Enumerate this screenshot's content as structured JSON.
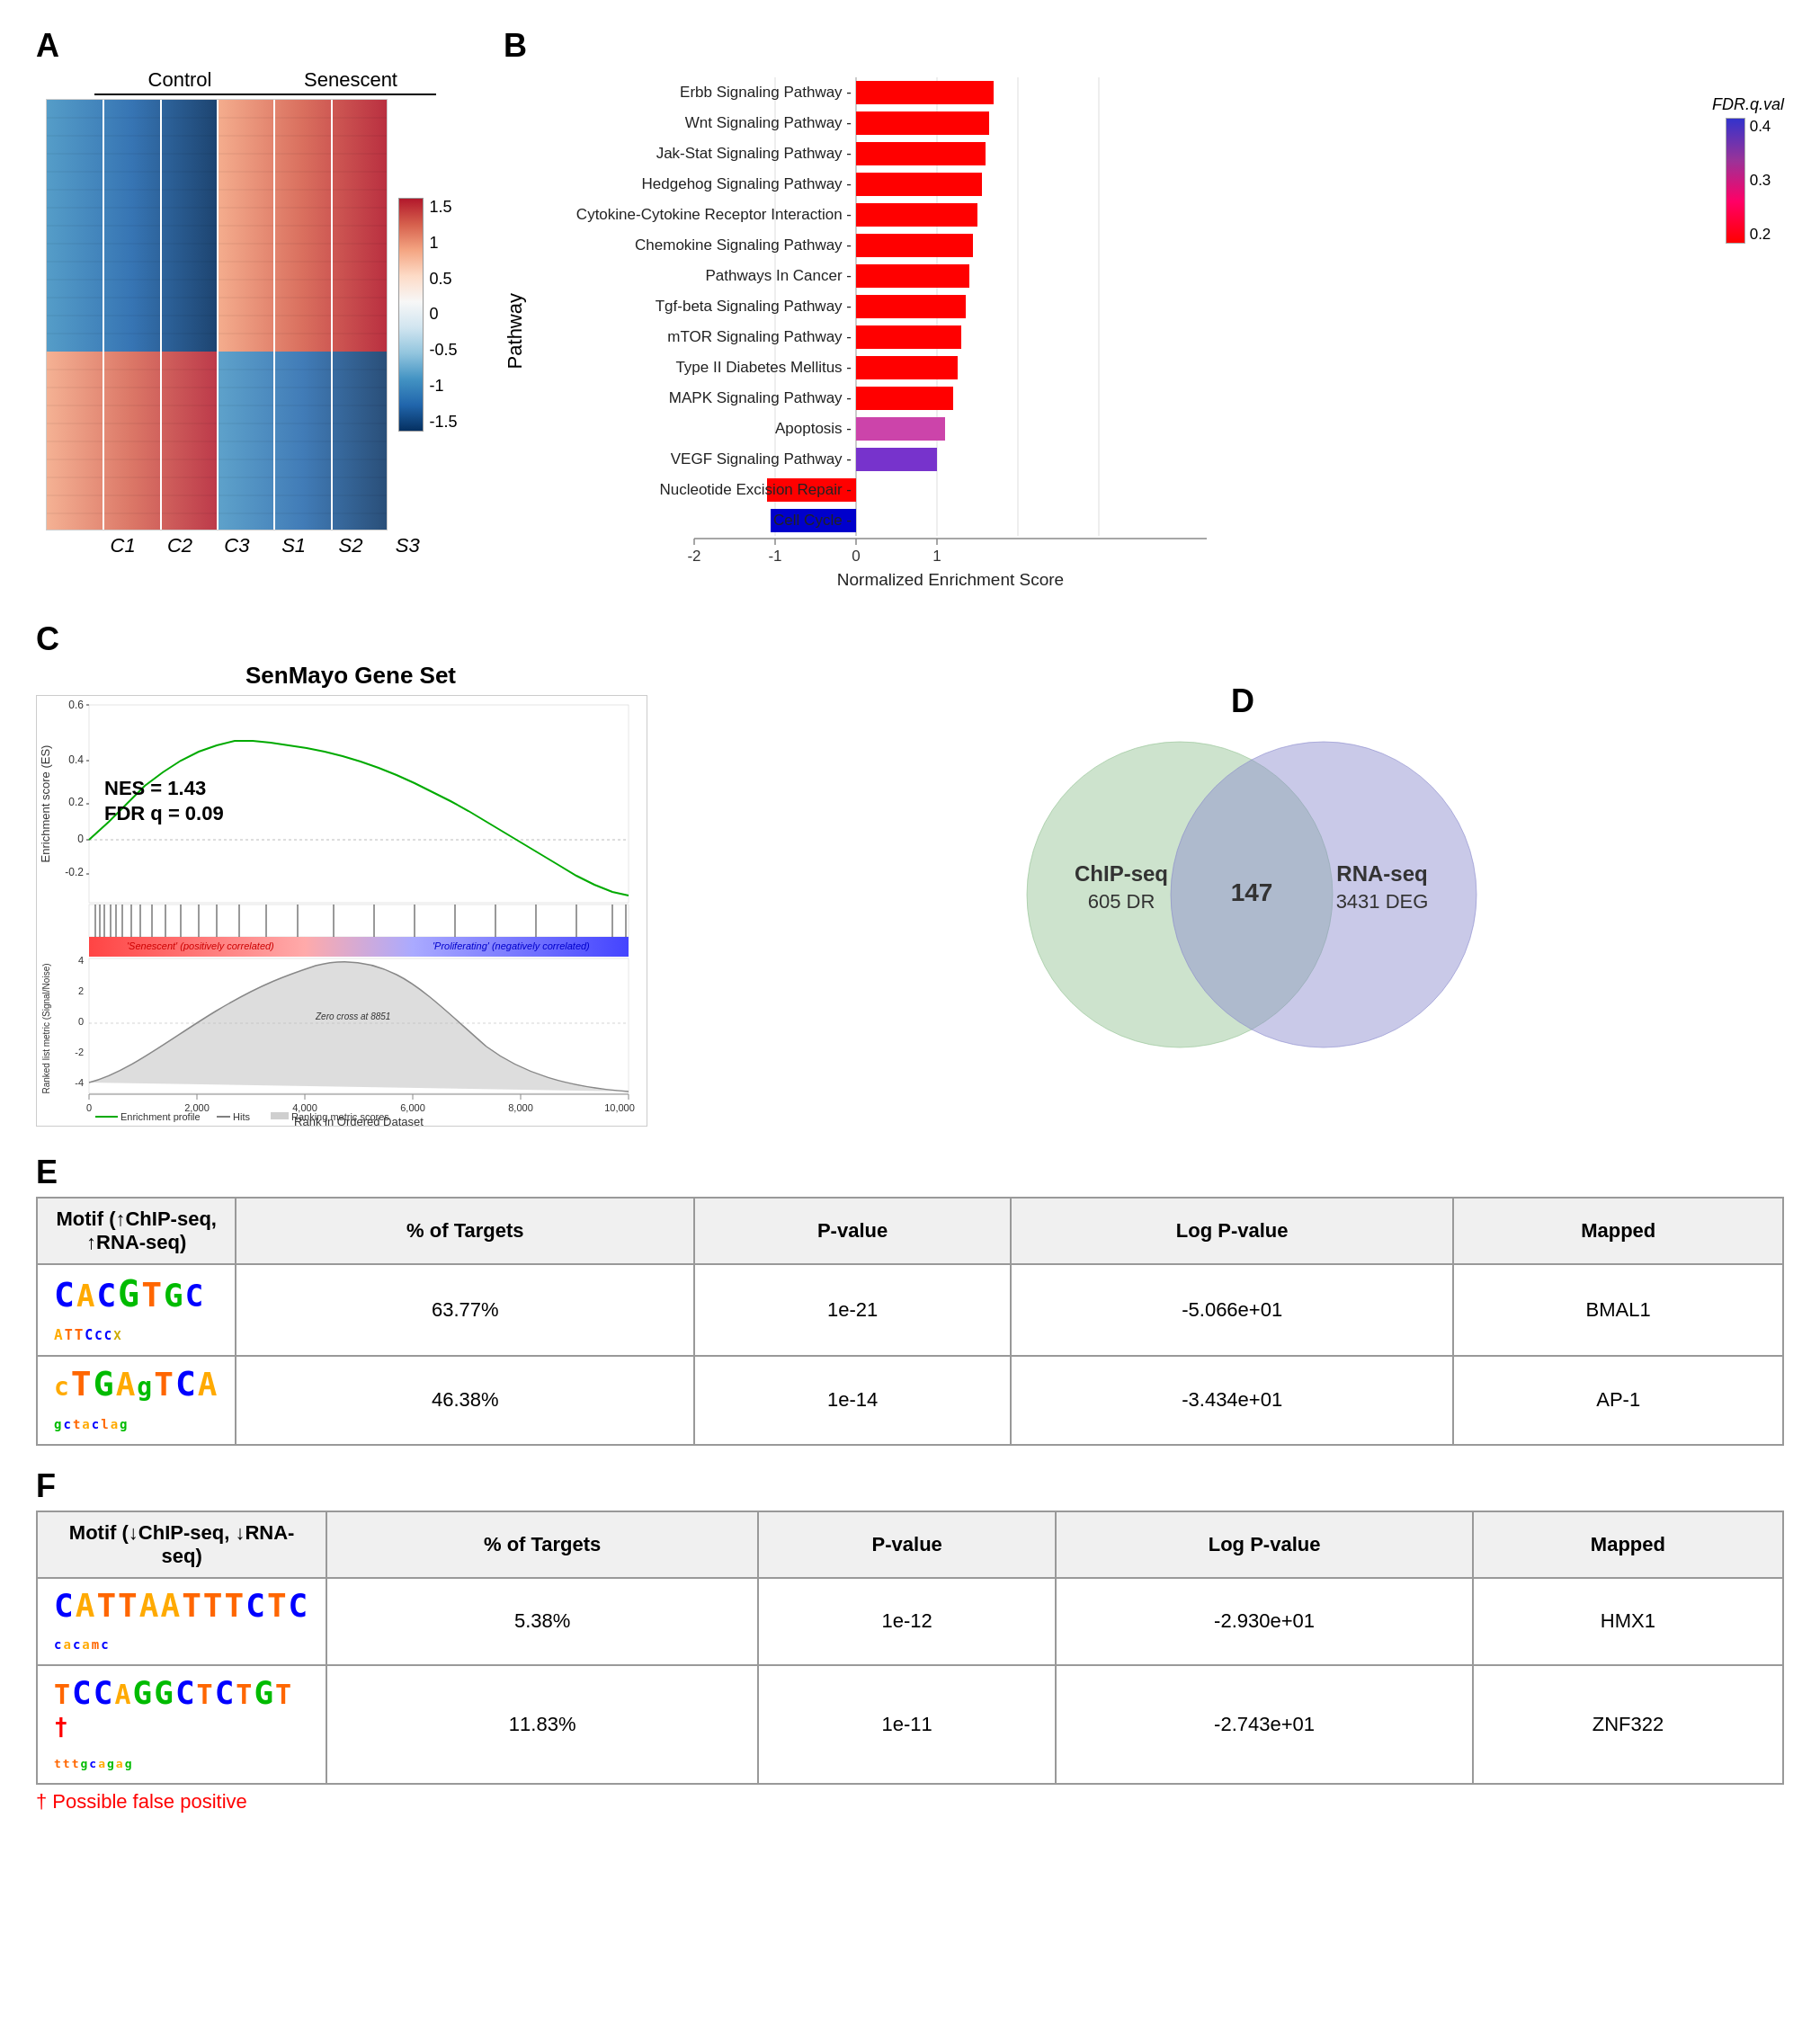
{
  "panels": {
    "a": {
      "label": "A",
      "groups": {
        "control": "Control",
        "senescent": "Senescent"
      },
      "col_labels": [
        "C1",
        "C2",
        "C3",
        "S1",
        "S2",
        "S3"
      ],
      "colorbar": {
        "max": "1.5",
        "mid1": "1",
        "mid2": "0.5",
        "zero": "0",
        "neg1": "-0.5",
        "neg2": "-1",
        "min": "-1.5"
      }
    },
    "b": {
      "label": "B",
      "ylabel": "Pathway",
      "xlabel": "Normalized Enrichment Score",
      "legend_title": "FDR.q.val",
      "legend_values": [
        "0.4",
        "0.3",
        "0.2"
      ],
      "pathways": [
        {
          "name": "Erbb Signaling Pathway",
          "nes": 1.7,
          "fdr": 0.0
        },
        {
          "name": "Wnt Signaling Pathway",
          "nes": 1.65,
          "fdr": 0.0
        },
        {
          "name": "Jak-Stat Signaling Pathway",
          "nes": 1.6,
          "fdr": 0.0
        },
        {
          "name": "Hedgehog Signaling Pathway",
          "nes": 1.55,
          "fdr": 0.05
        },
        {
          "name": "Cytokine-Cytokine Receptor Interaction",
          "nes": 1.5,
          "fdr": 0.0
        },
        {
          "name": "Chemokine Signaling Pathway",
          "nes": 1.45,
          "fdr": 0.0
        },
        {
          "name": "Pathways In Cancer",
          "nes": 1.4,
          "fdr": 0.0
        },
        {
          "name": "Tgf-beta Signaling Pathway",
          "nes": 1.35,
          "fdr": 0.0
        },
        {
          "name": "mTOR Signaling Pathway",
          "nes": 1.3,
          "fdr": 0.05
        },
        {
          "name": "Type II Diabetes Mellitus",
          "nes": 1.25,
          "fdr": 0.0
        },
        {
          "name": "MAPK Signaling Pathway",
          "nes": 1.2,
          "fdr": 0.05
        },
        {
          "name": "Apoptosis",
          "nes": 1.1,
          "fdr": 0.2
        },
        {
          "name": "VEGF Signaling Pathway",
          "nes": 1.0,
          "fdr": 0.35
        },
        {
          "name": "Nucleotide Excision Repair",
          "nes": -1.1,
          "fdr": 0.0
        },
        {
          "name": "Cell Cycle",
          "nes": -1.05,
          "fdr": 0.35
        }
      ]
    },
    "c": {
      "label": "C",
      "title": "SenMayo Gene Set",
      "nes": "NES = 1.43",
      "fdr": "FDR q = 0.09",
      "xlabel": "Rank in Ordered Dataset",
      "ylabel_top": "Enrichment score (ES)",
      "ylabel_bottom": "Ranked list metric (Signal/Noise)",
      "annotations": {
        "senescent": "'Senescent' (positively correlated)",
        "proliferating": "'Proliferating' (negatively correlated)",
        "zero_cross": "Zero cross at 8851"
      },
      "legend": {
        "enrichment": "Enrichment profile",
        "hits": "Hits",
        "ranking": "Ranking metric scores"
      }
    },
    "d": {
      "label": "D",
      "chip_label": "ChIP-seq",
      "chip_count": "605 DR",
      "rna_label": "RNA-seq",
      "rna_count": "3431 DEG",
      "overlap": "147"
    },
    "e": {
      "label": "E",
      "table_header": {
        "motif": "Motif (↑ChIP-seq, ↑RNA-seq)",
        "pct_targets": "% of Targets",
        "pvalue": "P-value",
        "log_pvalue": "Log P-value",
        "mapped": "Mapped"
      },
      "rows": [
        {
          "motif_seq": "CACGTGC",
          "motif_sub": "ATTCCCX",
          "pct": "63.77%",
          "pvalue": "1e-21",
          "log_pvalue": "-5.066e+01",
          "mapped": "BMAL1"
        },
        {
          "motif_seq": "CTGAGTCA",
          "motif_sub": "GCTACLAG",
          "pct": "46.38%",
          "pvalue": "1e-14",
          "log_pvalue": "-3.434e+01",
          "mapped": "AP-1"
        }
      ]
    },
    "f": {
      "label": "F",
      "table_header": {
        "motif": "Motif (↓ChIP-seq, ↓RNA-seq)",
        "pct_targets": "% of Targets",
        "pvalue": "P-value",
        "log_pvalue": "Log P-value",
        "mapped": "Mapped"
      },
      "rows": [
        {
          "motif_seq": "CATTAATTTCTC",
          "motif_sub": "CACAMC",
          "pct": "5.38%",
          "pvalue": "1e-12",
          "log_pvalue": "-2.930e+01",
          "mapped": "HMX1",
          "false_positive": false
        },
        {
          "motif_seq": "TCCAGGCTCTGT",
          "motif_sub": "TTTGCAGAG",
          "pct": "11.83%",
          "pvalue": "1e-11",
          "log_pvalue": "-2.743e+01",
          "mapped": "ZNF322",
          "false_positive": true
        }
      ],
      "false_positive_note": "† Possible false positive"
    }
  }
}
